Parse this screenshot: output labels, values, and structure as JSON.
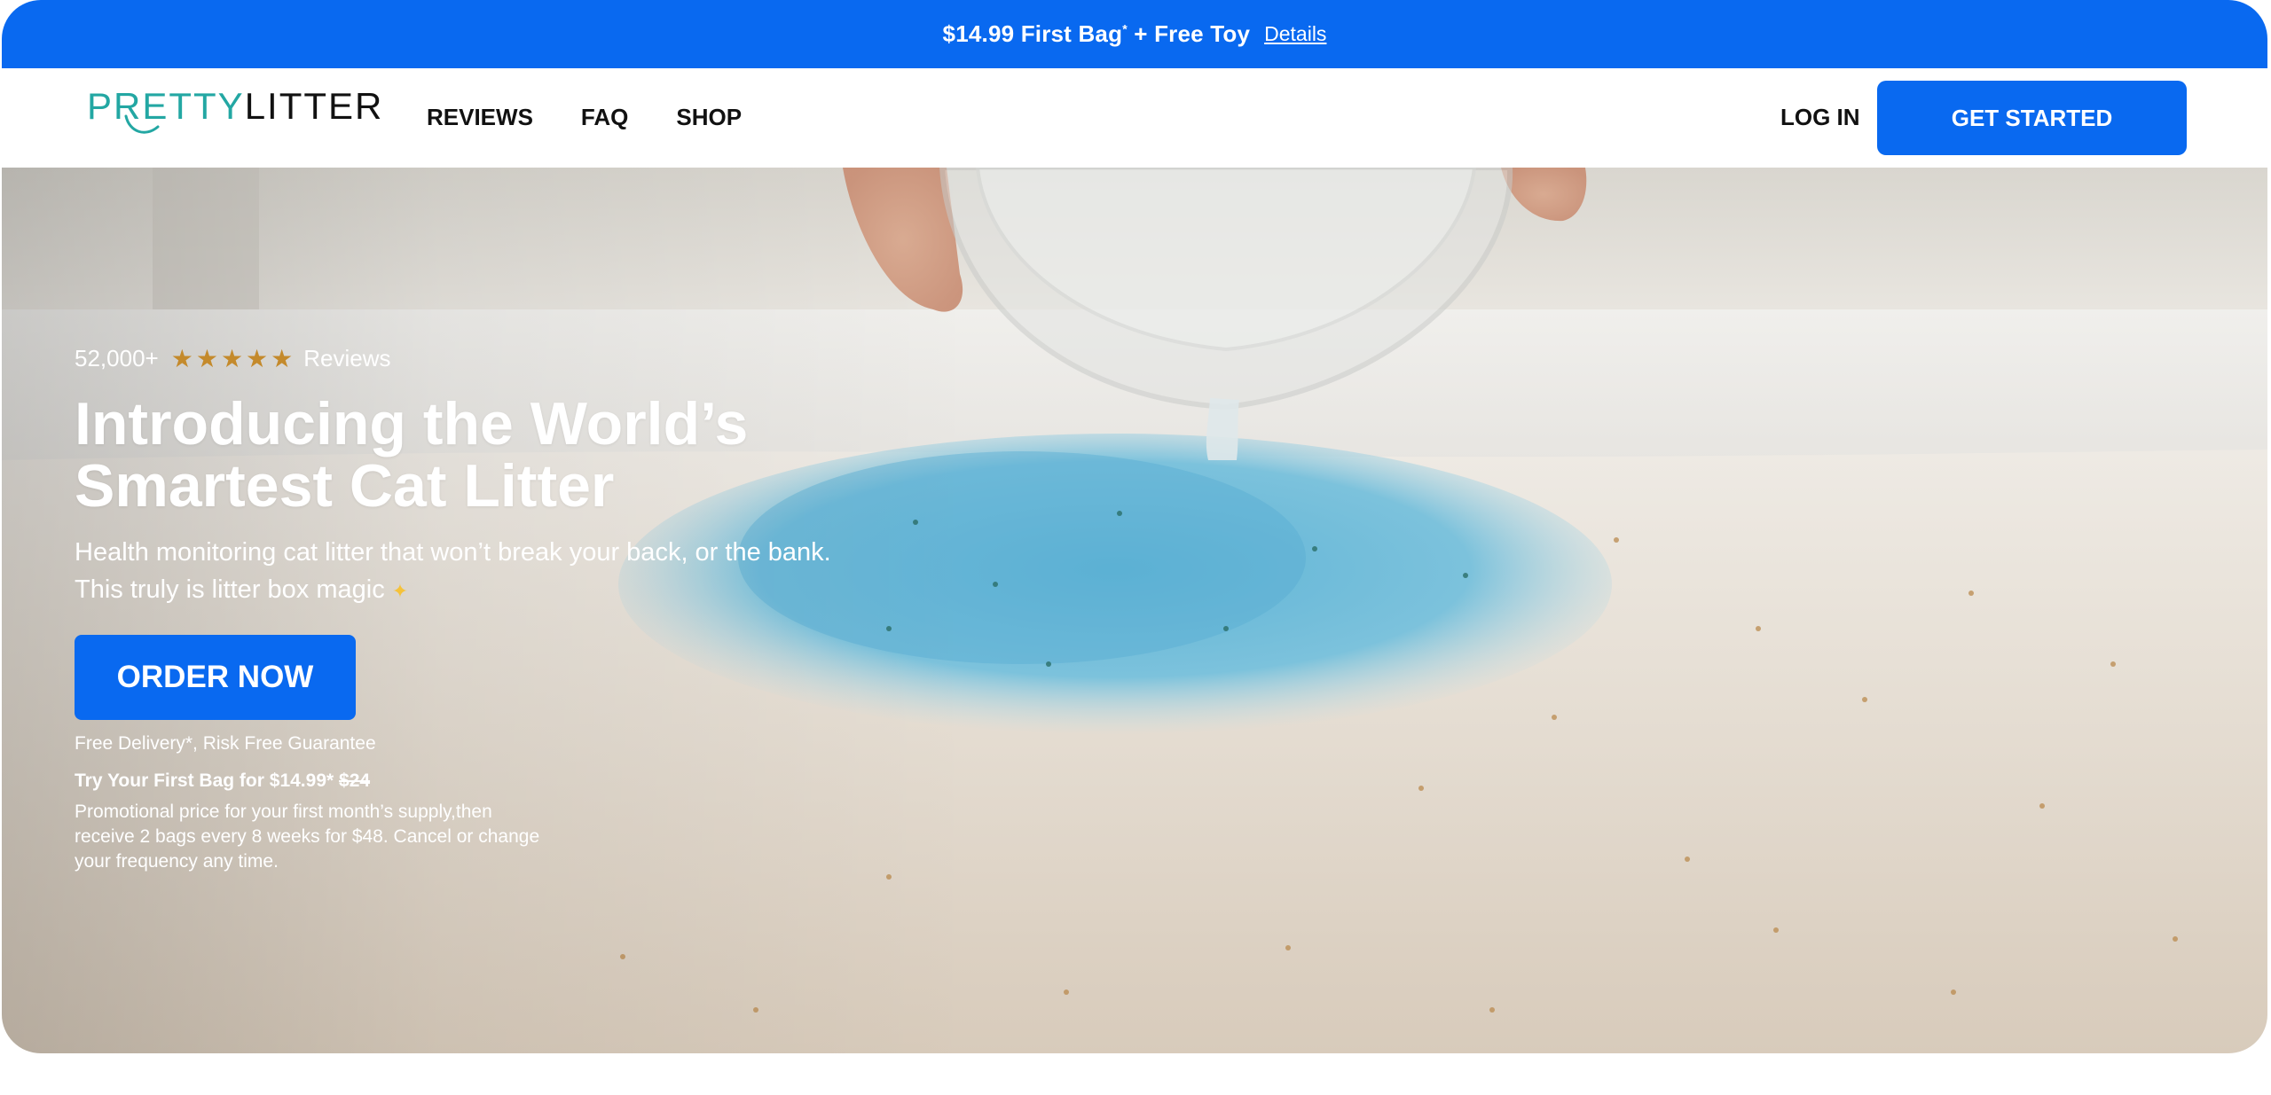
{
  "promo_bar": {
    "price_text": "$14.99 First Bag",
    "asterisk": "*",
    "extra_text": " + Free Toy",
    "details_link": "Details",
    "background_color": "#0969f0"
  },
  "header": {
    "logo": {
      "part_1": "PRETTY",
      "part_2": "LITTER",
      "part_1_color": "#23a7a3"
    },
    "nav": [
      {
        "label": "REVIEWS"
      },
      {
        "label": "FAQ"
      },
      {
        "label": "SHOP"
      }
    ],
    "login_label": "LOG IN",
    "get_started_label": "GET STARTED"
  },
  "hero": {
    "review_count": "52,000+",
    "star_icon": "star-icon",
    "stars_rating": 5,
    "reviews_label": "Reviews",
    "headline_line_1": "Introducing the World’s",
    "headline_line_2": "Smartest Cat Litter",
    "subline_1": "Health monitoring cat litter that won’t break your back, or the bank.",
    "subline_2": "This truly is litter box magic",
    "sparkle_icon": "sparkle-icon",
    "order_button_label": "ORDER NOW",
    "guarantee_text": "Free Delivery*, Risk Free Guarantee",
    "try_text": "Try Your First Bag for $14.99*",
    "old_price": "$24",
    "fine_print": "Promotional price for your first month’s supply,then receive 2 bags every 8 weeks for $48. Cancel or change your frequency any time.",
    "star_color": "#c48a2c",
    "accent_color": "#0969f0"
  }
}
